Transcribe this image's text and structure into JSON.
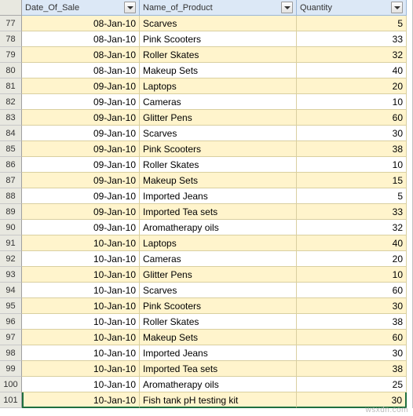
{
  "columns": [
    {
      "label": "Date_Of_Sale",
      "align": "right"
    },
    {
      "label": "Name_of_Product",
      "align": "left"
    },
    {
      "label": "Quantity",
      "align": "right"
    }
  ],
  "startRow": 77,
  "selectedRow": 101,
  "rows": [
    {
      "n": 77,
      "band": true,
      "date": "08-Jan-10",
      "product": "Scarves",
      "qty": 5
    },
    {
      "n": 78,
      "band": false,
      "date": "08-Jan-10",
      "product": "Pink Scooters",
      "qty": 33
    },
    {
      "n": 79,
      "band": true,
      "date": "08-Jan-10",
      "product": "Roller Skates",
      "qty": 32
    },
    {
      "n": 80,
      "band": false,
      "date": "08-Jan-10",
      "product": "Makeup Sets",
      "qty": 40
    },
    {
      "n": 81,
      "band": true,
      "date": "09-Jan-10",
      "product": "Laptops",
      "qty": 20
    },
    {
      "n": 82,
      "band": false,
      "date": "09-Jan-10",
      "product": "Cameras",
      "qty": 10
    },
    {
      "n": 83,
      "band": true,
      "date": "09-Jan-10",
      "product": "Glitter Pens",
      "qty": 60
    },
    {
      "n": 84,
      "band": false,
      "date": "09-Jan-10",
      "product": "Scarves",
      "qty": 30
    },
    {
      "n": 85,
      "band": true,
      "date": "09-Jan-10",
      "product": "Pink Scooters",
      "qty": 38
    },
    {
      "n": 86,
      "band": false,
      "date": "09-Jan-10",
      "product": "Roller Skates",
      "qty": 10
    },
    {
      "n": 87,
      "band": true,
      "date": "09-Jan-10",
      "product": "Makeup Sets",
      "qty": 15
    },
    {
      "n": 88,
      "band": false,
      "date": "09-Jan-10",
      "product": "Imported Jeans",
      "qty": 5
    },
    {
      "n": 89,
      "band": true,
      "date": "09-Jan-10",
      "product": "Imported Tea sets",
      "qty": 33
    },
    {
      "n": 90,
      "band": false,
      "date": "09-Jan-10",
      "product": "Aromatherapy oils",
      "qty": 32
    },
    {
      "n": 91,
      "band": true,
      "date": "10-Jan-10",
      "product": "Laptops",
      "qty": 40
    },
    {
      "n": 92,
      "band": false,
      "date": "10-Jan-10",
      "product": "Cameras",
      "qty": 20
    },
    {
      "n": 93,
      "band": true,
      "date": "10-Jan-10",
      "product": "Glitter Pens",
      "qty": 10
    },
    {
      "n": 94,
      "band": false,
      "date": "10-Jan-10",
      "product": "Scarves",
      "qty": 60
    },
    {
      "n": 95,
      "band": true,
      "date": "10-Jan-10",
      "product": "Pink Scooters",
      "qty": 30
    },
    {
      "n": 96,
      "band": false,
      "date": "10-Jan-10",
      "product": "Roller Skates",
      "qty": 38
    },
    {
      "n": 97,
      "band": true,
      "date": "10-Jan-10",
      "product": "Makeup Sets",
      "qty": 60
    },
    {
      "n": 98,
      "band": false,
      "date": "10-Jan-10",
      "product": "Imported Jeans",
      "qty": 30
    },
    {
      "n": 99,
      "band": true,
      "date": "10-Jan-10",
      "product": "Imported Tea sets",
      "qty": 38
    },
    {
      "n": 100,
      "band": false,
      "date": "10-Jan-10",
      "product": "Aromatherapy oils",
      "qty": 25
    },
    {
      "n": 101,
      "band": true,
      "date": "10-Jan-10",
      "product": "Fish tank pH testing kit",
      "qty": 30
    }
  ],
  "watermark": "wsxdn.com"
}
